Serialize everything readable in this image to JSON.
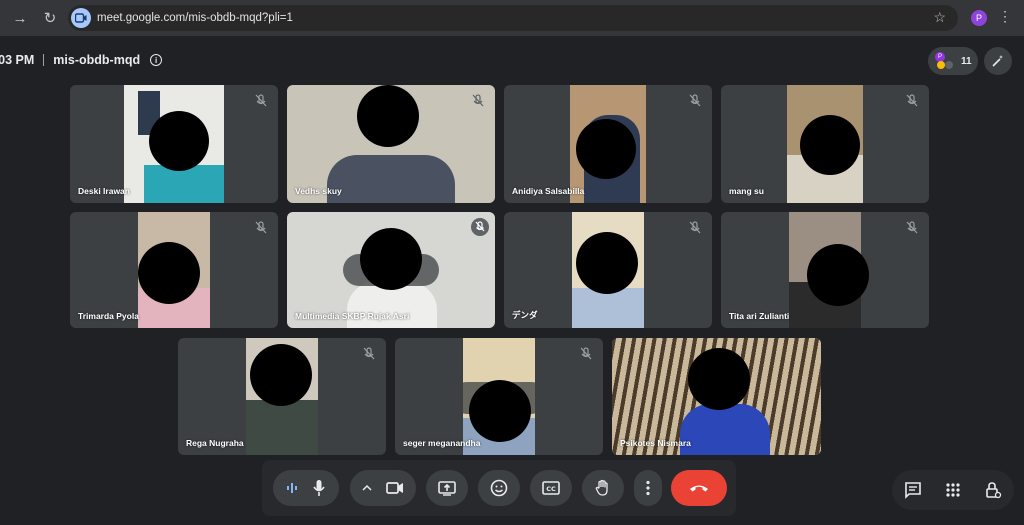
{
  "browser": {
    "url": "meet.google.com/mis-obdb-mqd?pli=1",
    "profile_initial": "P"
  },
  "meeting": {
    "time": ":03 PM",
    "code": "mis-obdb-mqd",
    "info_glyph": "i",
    "participant_count": "11",
    "people_avatar_initial": "P"
  },
  "participants": [
    {
      "name": "Deski Irawan",
      "muted": true
    },
    {
      "name": "Vedhs skuy",
      "muted": true
    },
    {
      "name": "Anidiya Salsabilla",
      "muted": true
    },
    {
      "name": "mang su",
      "muted": true
    },
    {
      "name": "Trimarda Pyola",
      "muted": true
    },
    {
      "name": "Multimedia SKBP Rujak Asri",
      "muted": true
    },
    {
      "name": "デンダ",
      "muted": true
    },
    {
      "name": "Tita ari Zulianti",
      "muted": true
    },
    {
      "name": "Rega Nugraha",
      "muted": true
    },
    {
      "name": "seger meganandha",
      "muted": true
    },
    {
      "name": "Psikotes Nismara",
      "muted": false
    }
  ],
  "controls": {
    "icons": [
      "audio-level-icon",
      "mic-icon",
      "chevron-up-icon",
      "camera-icon",
      "present-icon",
      "emoji-icon",
      "captions-icon",
      "raise-hand-icon",
      "more-options-icon",
      "end-call-icon"
    ],
    "right_icons": [
      "chat-icon",
      "activities-icon",
      "host-controls-icon"
    ]
  },
  "colors": {
    "background": "#202124",
    "tile": "#3c4043",
    "end_call": "#ea4335",
    "active_border": "#8ab4f8"
  }
}
